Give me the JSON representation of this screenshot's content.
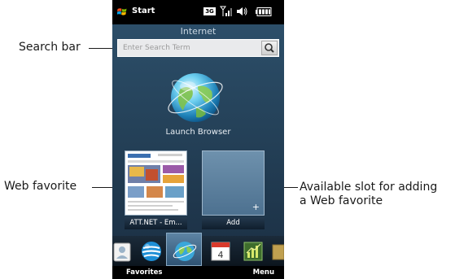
{
  "callouts": {
    "search_bar": "Search bar",
    "web_favorite": "Web favorite",
    "available_slot_line1": "Available slot for adding",
    "available_slot_line2": "a Web favorite"
  },
  "status_bar": {
    "start_label": "Start",
    "network_badge": "3G"
  },
  "screen": {
    "title": "Internet",
    "search": {
      "placeholder": "Enter Search Term",
      "value": ""
    },
    "launch_label": "Launch Browser",
    "favorites": [
      {
        "caption": "ATT.NET - Em...",
        "filled": true
      },
      {
        "caption": "Add",
        "filled": false
      }
    ]
  },
  "tabs": [
    {
      "icon": "contacts-icon"
    },
    {
      "icon": "att-icon"
    },
    {
      "icon": "internet-globe-icon",
      "active": true
    },
    {
      "icon": "calendar-icon",
      "day": "4"
    },
    {
      "icon": "stocks-icon"
    }
  ],
  "softkeys": {
    "left": "Favorites",
    "right": "Menu"
  },
  "colors": {
    "panel": "#26445c",
    "accent": "#5d84a4",
    "statusbar": "#000000"
  }
}
